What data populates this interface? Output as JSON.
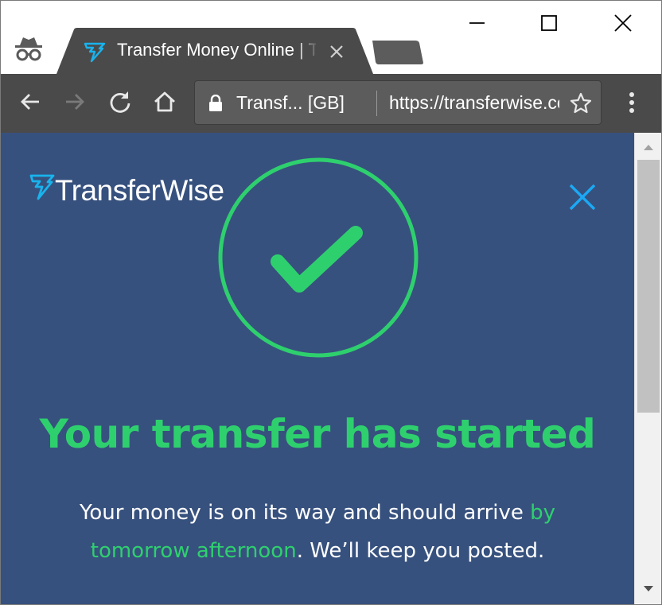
{
  "window": {
    "controls": [
      "minimize",
      "maximize",
      "close"
    ]
  },
  "tab": {
    "title": "Transfer Money Online | TransferWise",
    "favicon": "transferwise-flag-icon",
    "close_icon": "close-icon"
  },
  "toolbar": {
    "back_icon": "arrow-left-icon",
    "forward_icon": "arrow-right-icon",
    "reload_icon": "reload-icon",
    "home_icon": "home-icon",
    "menu_icon": "vertical-dots-icon"
  },
  "omnibox": {
    "security_label": "Transf... [GB]",
    "url": "https://transferwise.com",
    "lock_icon": "lock-icon",
    "star_icon": "star-icon"
  },
  "page": {
    "logo_text": "TransferWise",
    "headline": "Your transfer has started",
    "message_part1": "Your money is on its way and should arrive ",
    "message_highlight": "by tomorrow afternoon",
    "message_part2": ". We’ll keep you posted.",
    "colors": {
      "background": "#37517e",
      "accent_green": "#2ed06e",
      "close_blue": "#1aa9f5",
      "logo_blue": "#19b3ed"
    }
  }
}
